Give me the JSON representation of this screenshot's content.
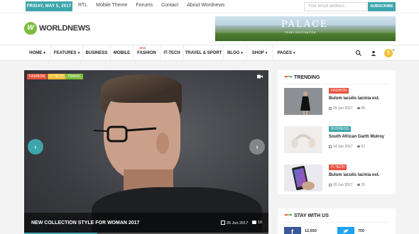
{
  "topbar": {
    "date": "FRIDAY, MAY 5, 2017",
    "links": [
      "RTL",
      "Mobile Theme",
      "Forums",
      "Contact",
      "About Wordnews"
    ],
    "email_placeholder": "Your email address",
    "subscribe_label": "SUBSCRIBE"
  },
  "header": {
    "logo_letter": "W",
    "logo_text": "WORLDNEWS",
    "ad_title": "PALACE",
    "ad_subtitle": "PRIME DESTINATION"
  },
  "nav": {
    "items": [
      {
        "label": "HOME",
        "caret": true
      },
      {
        "label": "FEATURES",
        "caret": true
      },
      {
        "label": "BUSINESS",
        "caret": false
      },
      {
        "label": "MOBILE",
        "caret": false
      },
      {
        "label": "FASHION",
        "caret": false,
        "badge": "NEW"
      },
      {
        "label": "IT-TECH",
        "caret": false
      },
      {
        "label": "TRAVEL & SPORT",
        "caret": false
      },
      {
        "label": "BLOG",
        "caret": true
      },
      {
        "label": "SHOP",
        "caret": true
      },
      {
        "label": "PAGES",
        "caret": true
      }
    ],
    "cart_symbol": "$",
    "cart_count": "0"
  },
  "hero": {
    "tags": [
      {
        "label": "FASHION",
        "color": "#e8523f"
      },
      {
        "label": "IT-TECH",
        "color": "#f2c035"
      },
      {
        "label": "TRAVEL",
        "color": "#7cbd3e"
      }
    ],
    "prev_icon": "‹",
    "next_icon": "›",
    "title": "NEW COLLECTION STYLE FOR WOMAN 2017",
    "date": "20 Jun 2017",
    "comments": "10",
    "slide_progress": 0.3
  },
  "trending": {
    "heading": "TRENDING",
    "items": [
      {
        "category": "FASHION",
        "cat_color": "#e8523f",
        "title": "Bulum iaculis lacinia est.",
        "date": "20 Jun 2017",
        "comments": "06"
      },
      {
        "category": "BUSINESS",
        "cat_color": "#3ea5ac",
        "title": "South African Garth Mulroy",
        "date": "14 Jun 2017",
        "comments": "07"
      },
      {
        "category": "IT-TECH",
        "cat_color": "#e8523f",
        "title": "Bulum iaculis lacinia est.",
        "date": "20 Jun 2017",
        "comments": "15"
      }
    ]
  },
  "stay": {
    "heading": "STAY WITH US",
    "facebook_count": "12,650",
    "twitter_count": "700"
  },
  "colors": {
    "accent": "#3ea5ac",
    "red": "#e8523f",
    "yellow": "#f2c035",
    "green": "#7cbd3e",
    "facebook": "#3b5998",
    "twitter": "#1da1f2"
  }
}
